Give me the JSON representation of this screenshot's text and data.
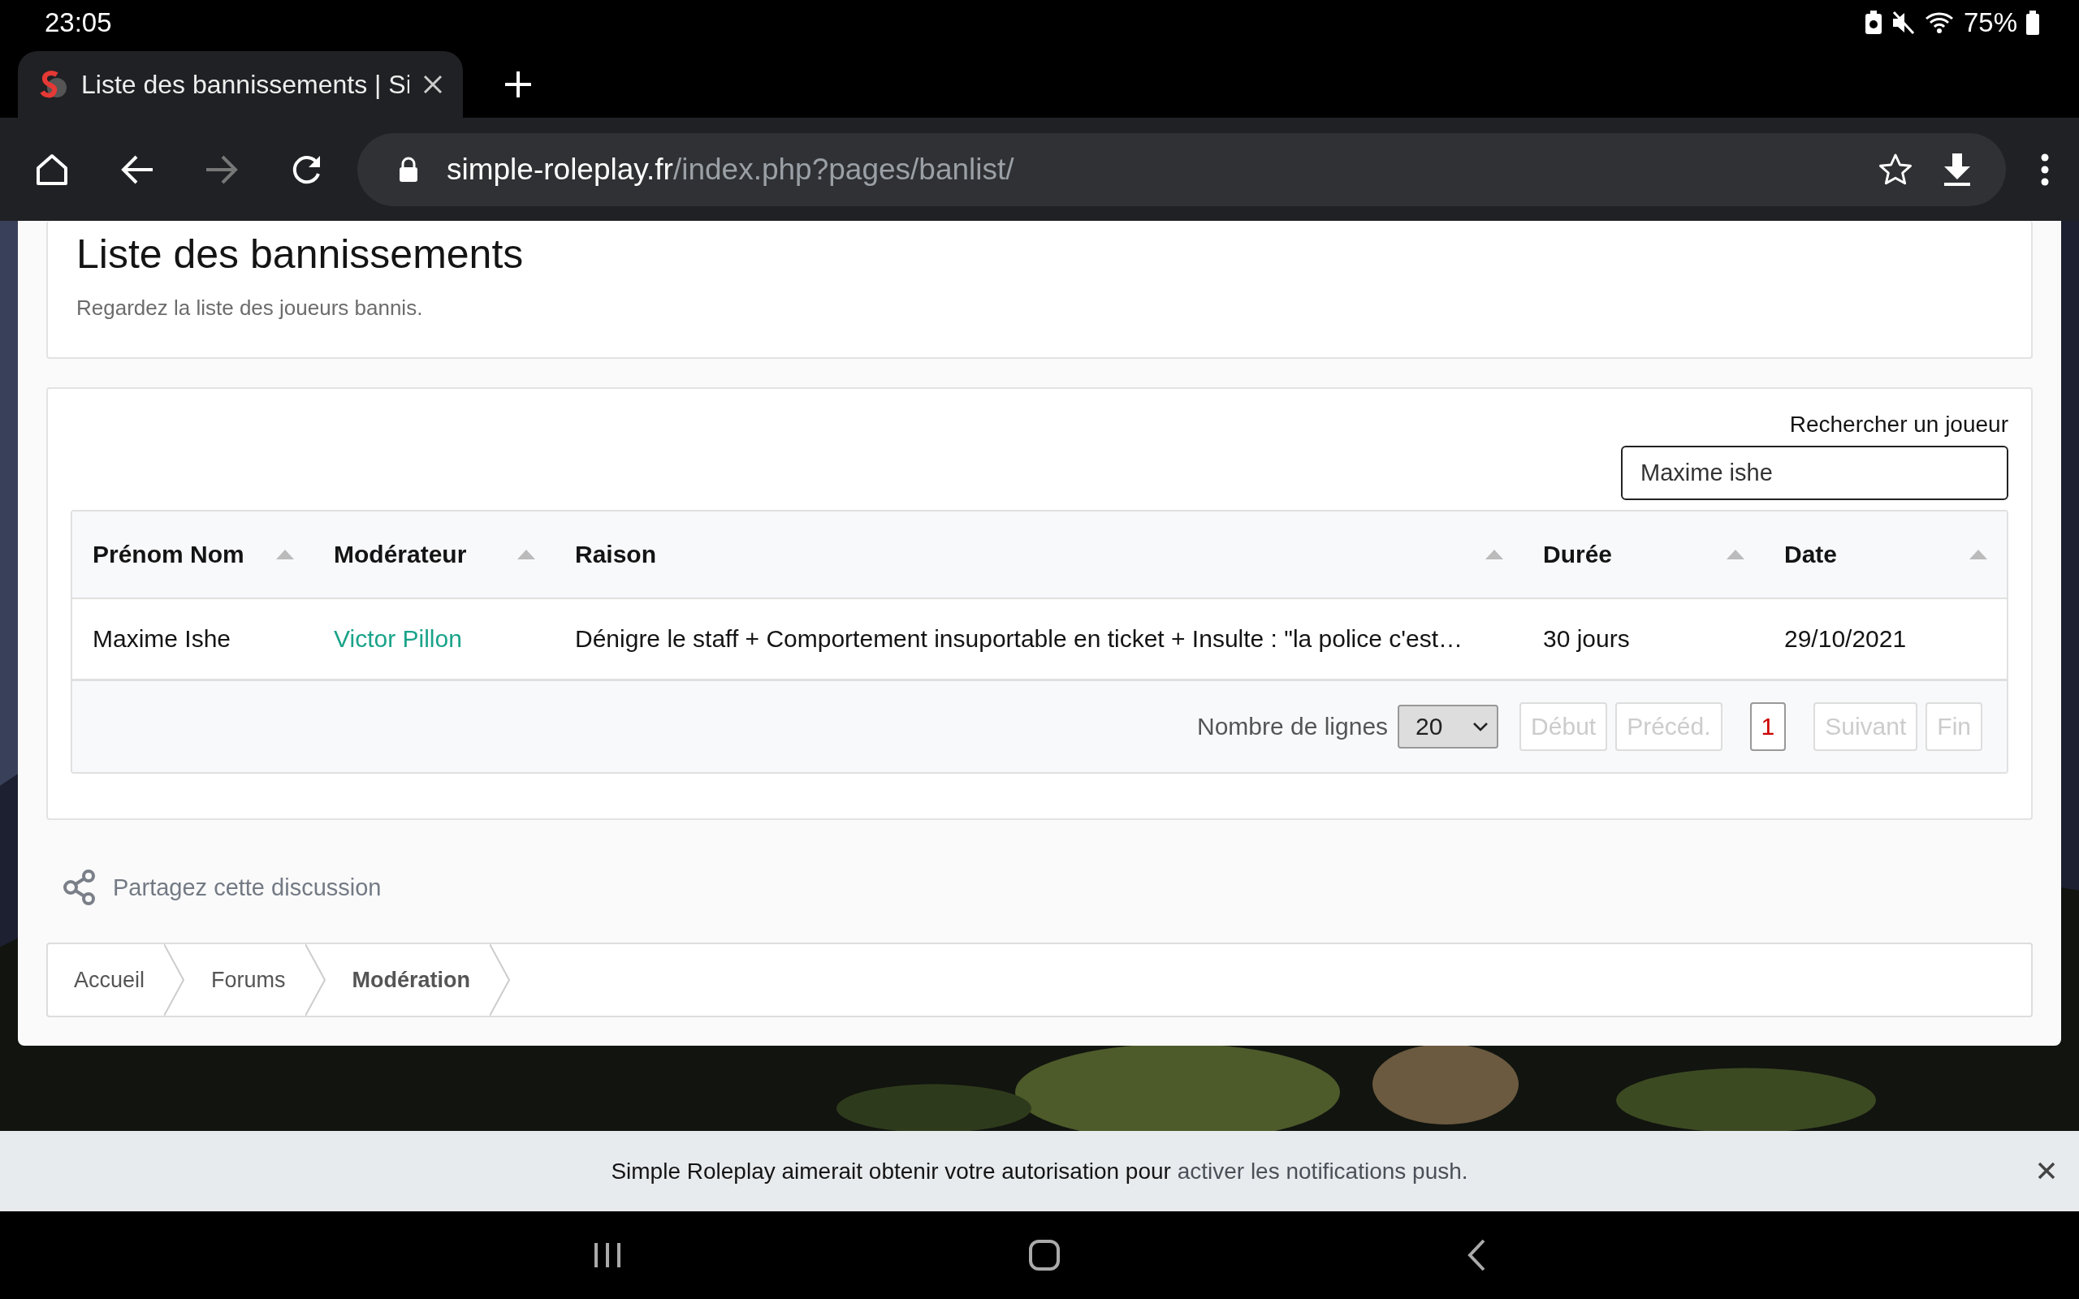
{
  "status_bar": {
    "time": "23:05",
    "battery": "75%"
  },
  "browser": {
    "tab_title": "Liste des bannissements | Si",
    "url_host": "simple-roleplay.fr",
    "url_path": "/index.php?pages/banlist/"
  },
  "page_header": {
    "title": "Liste des bannissements",
    "subtitle": "Regardez la liste des joueurs bannis."
  },
  "search": {
    "label": "Rechercher un joueur",
    "value": "Maxime ishe"
  },
  "table": {
    "columns": [
      "Prénom Nom",
      "Modérateur",
      "Raison",
      "Durée",
      "Date"
    ],
    "rows": [
      {
        "cells": [
          "Maxime Ishe",
          "Victor Pillon",
          "Dénigre le staff + Comportement insuportable en ticket + Insulte : \"la police c'est…",
          "30 jours",
          "29/10/2021"
        ]
      }
    ]
  },
  "pagination": {
    "rows_label": "Nombre de lignes",
    "page_size": "20",
    "buttons": [
      {
        "label": "Début",
        "disabled": true,
        "selected": false
      },
      {
        "label": "Précéd.",
        "disabled": true,
        "selected": false
      },
      {
        "label": "1",
        "disabled": false,
        "selected": true
      },
      {
        "label": "Suivant",
        "disabled": true,
        "selected": false
      },
      {
        "label": "Fin",
        "disabled": true,
        "selected": false
      }
    ]
  },
  "share": "Partagez cette discussion",
  "breadcrumb": [
    {
      "label": "Accueil",
      "current": false
    },
    {
      "label": "Forums",
      "current": false
    },
    {
      "label": "Modération",
      "current": true
    }
  ],
  "notification": {
    "text": "Simple Roleplay aimerait obtenir votre autorisation pour",
    "link": "activer les notifications push."
  }
}
